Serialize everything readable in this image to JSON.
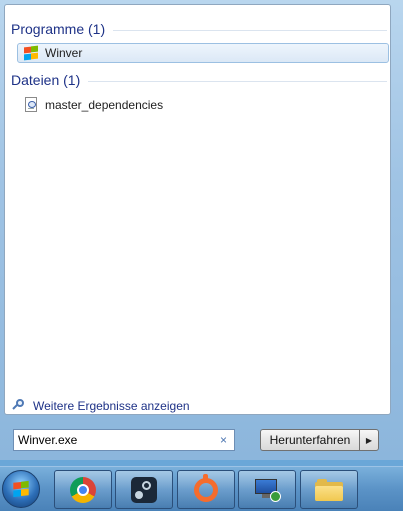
{
  "results": {
    "groups": [
      {
        "title": "Programme (1)",
        "items": [
          {
            "label": "Winver",
            "icon": "windows-flag-icon",
            "selected": true
          }
        ]
      },
      {
        "title": "Dateien (1)",
        "items": [
          {
            "label": "master_dependencies",
            "icon": "document-file-icon",
            "selected": false
          }
        ]
      }
    ],
    "more_results_label": "Weitere Ergebnisse anzeigen"
  },
  "search": {
    "value": "Winver.exe",
    "clear_glyph": "×"
  },
  "shutdown": {
    "label": "Herunterfahren",
    "arrow_glyph": "▶"
  },
  "taskbar": {
    "items": [
      {
        "icon": "windows-start-orb-icon"
      },
      {
        "icon": "chrome-icon"
      },
      {
        "icon": "steam-icon"
      },
      {
        "icon": "origin-icon"
      },
      {
        "icon": "remote-desktop-icon"
      },
      {
        "icon": "file-explorer-icon"
      }
    ]
  },
  "colors": {
    "group_title": "#1e3287",
    "selection_border": "#9cc0e2",
    "taskbar": "#5b93c7"
  }
}
